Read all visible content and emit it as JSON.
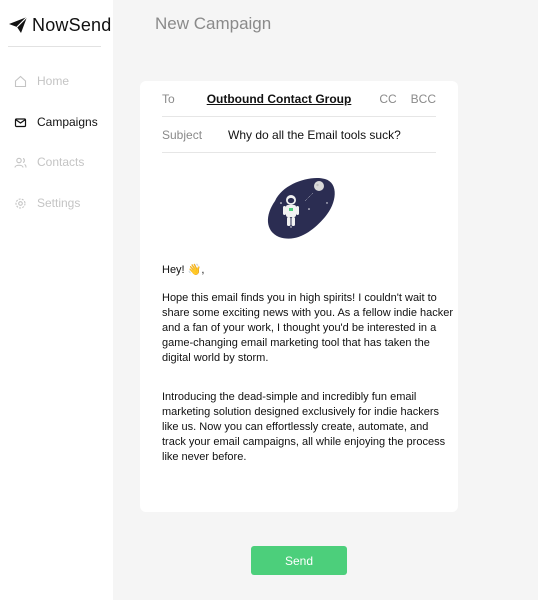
{
  "app": {
    "name": "NowSend"
  },
  "sidebar": {
    "items": [
      {
        "label": "Home",
        "icon": "home-icon"
      },
      {
        "label": "Campaigns",
        "icon": "mail-icon"
      },
      {
        "label": "Contacts",
        "icon": "users-icon"
      },
      {
        "label": "Settings",
        "icon": "gear-icon"
      }
    ],
    "active": "Campaigns"
  },
  "page": {
    "title": "New Campaign"
  },
  "email": {
    "to_label": "To",
    "to_value": "Outbound Contact Group",
    "cc_label": "CC",
    "bcc_label": "BCC",
    "subject_label": "Subject",
    "subject_value": "Why do all the Email tools suck?",
    "greeting": "Hey! 👋,",
    "paragraph1": "Hope this email finds you in high spirits! I couldn't wait to share some exciting news with you. As a fellow indie hacker and a fan of your work, I thought you'd be interested in a game-changing email marketing tool that has taken the digital world by storm.",
    "paragraph2": "Introducing the dead-simple and incredibly fun email marketing solution designed exclusively for indie hackers like us. Now you can effortlessly create, automate, and track your email campaigns, all while enjoying the process like never before."
  },
  "actions": {
    "send_label": "Send"
  },
  "colors": {
    "accent": "#4ccf7b",
    "illustration": "#2b2d52"
  }
}
